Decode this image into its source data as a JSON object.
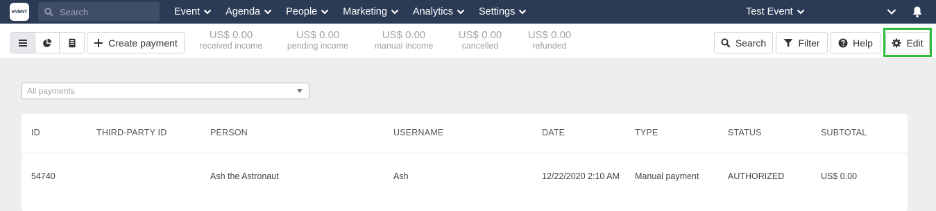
{
  "nav": {
    "logo_text": "EVENT",
    "search_placeholder": "Search",
    "menu": [
      "Event",
      "Agenda",
      "People",
      "Marketing",
      "Analytics",
      "Settings"
    ],
    "event_name": "Test Event"
  },
  "toolbar": {
    "create_label": "Create payment",
    "stats": [
      {
        "amount": "US$ 0.00",
        "label": "received income"
      },
      {
        "amount": "US$ 0.00",
        "label": "pending income"
      },
      {
        "amount": "US$ 0.00",
        "label": "manual income"
      },
      {
        "amount": "US$ 0.00",
        "label": "cancelled"
      },
      {
        "amount": "US$ 0.00",
        "label": "refunded"
      }
    ],
    "search_label": "Search",
    "filter_label": "Filter",
    "help_label": "Help",
    "edit_label": "Edit"
  },
  "filter": {
    "selected": "All payments"
  },
  "table": {
    "columns": [
      "ID",
      "THIRD-PARTY ID",
      "PERSON",
      "USERNAME",
      "DATE",
      "TYPE",
      "STATUS",
      "SUBTOTAL"
    ],
    "rows": [
      {
        "id": "54740",
        "third_party_id": "",
        "person": "Ash the Astronaut",
        "username": "Ash",
        "date": "12/22/2020 2:10 AM",
        "type": "Manual payment",
        "status": "AUTHORIZED",
        "subtotal": "US$ 0.00"
      }
    ]
  },
  "colors": {
    "nav_bg": "#2b3a55",
    "highlight": "#2ebd3d"
  }
}
